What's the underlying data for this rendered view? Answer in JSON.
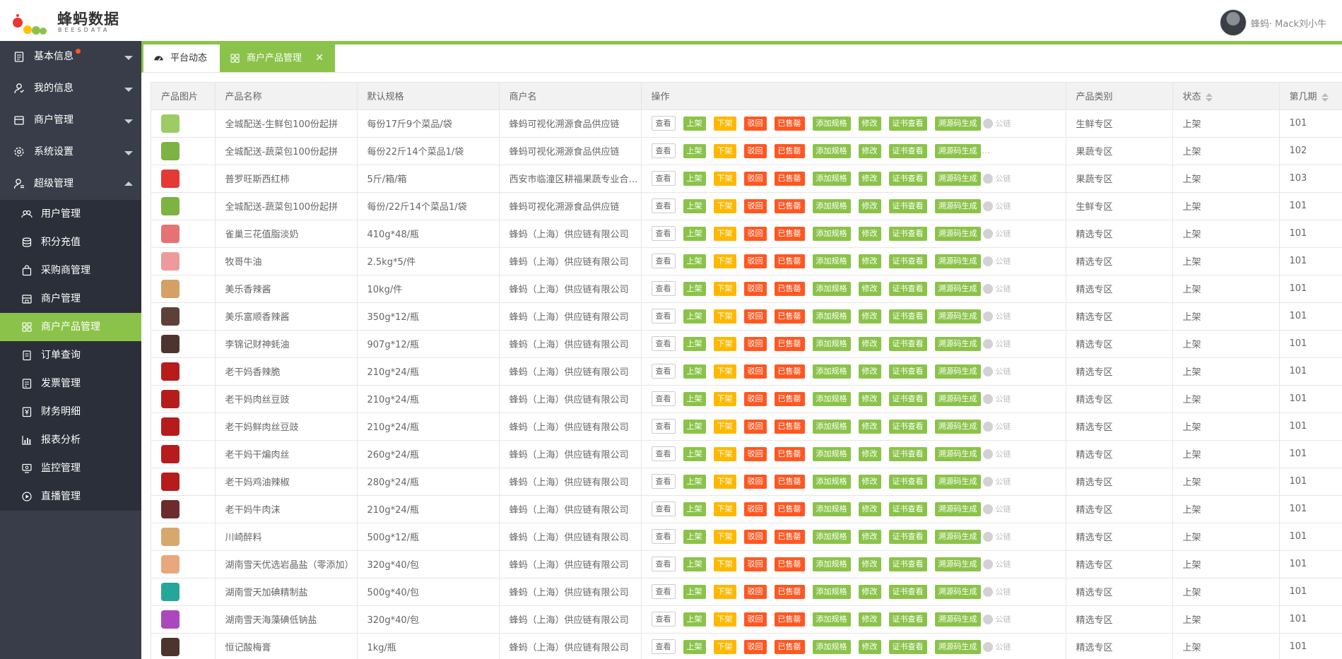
{
  "brand": {
    "name": "蜂蚂数据",
    "sub": "BEESDATA"
  },
  "user": {
    "name": "蜂蚂· Mack刘小牛"
  },
  "sidebar": {
    "top": [
      {
        "label": "基本信息",
        "icon": "clipboard-icon",
        "badge": true
      },
      {
        "label": "我的信息",
        "icon": "user-icon"
      },
      {
        "label": "商户管理",
        "icon": "store-icon"
      },
      {
        "label": "系统设置",
        "icon": "gear-icon"
      },
      {
        "label": "超级管理",
        "icon": "admin-user-icon",
        "expanded": true
      }
    ],
    "sub": [
      {
        "label": "用户管理",
        "icon": "users-icon"
      },
      {
        "label": "积分充值",
        "icon": "database-icon"
      },
      {
        "label": "采购商管理",
        "icon": "bag-icon"
      },
      {
        "label": "商户管理",
        "icon": "shop-icon"
      },
      {
        "label": "商户产品管理",
        "icon": "grid-icon",
        "active": true
      },
      {
        "label": "订单查询",
        "icon": "order-icon"
      },
      {
        "label": "发票管理",
        "icon": "invoice-icon"
      },
      {
        "label": "财务明细",
        "icon": "finance-icon"
      },
      {
        "label": "报表分析",
        "icon": "bar-chart-icon"
      },
      {
        "label": "监控管理",
        "icon": "monitor-icon"
      },
      {
        "label": "直播管理",
        "icon": "play-icon"
      }
    ]
  },
  "tabs": [
    {
      "label": "平台动态",
      "icon": "dashboard-icon"
    },
    {
      "label": "商户产品管理",
      "icon": "grid-icon",
      "active": true,
      "close": "✕"
    }
  ],
  "table": {
    "headers": [
      "产品图片",
      "产品名称",
      "默认规格",
      "商户名",
      "操作",
      "产品类别",
      "状态",
      "第几期"
    ],
    "op_labels": {
      "view": "查看",
      "on": "上架",
      "off": "下架",
      "reject": "驳回",
      "sold": "已售罄",
      "add_spec": "添加规格",
      "edit": "修改",
      "cert": "证书查看",
      "trace": "溯源码生成",
      "chain": "公链",
      "more": "…"
    },
    "colors": {
      "green": "#8bc34a",
      "orange": "#ffb800",
      "red": "#ff5722"
    },
    "rows": [
      {
        "name": "全城配送-生鲜包100份起拼",
        "spec": "每份17斤9个菜品/袋",
        "merchant": "蜂蚂可视化溯源食品供应链",
        "category": "生鲜专区",
        "status": "上架",
        "period": "101",
        "thumb": "#9ccc65",
        "chain": true
      },
      {
        "name": "全城配送-蔬菜包100份起拼",
        "spec": "每份22斤14个菜品1/袋",
        "merchant": "蜂蚂可视化溯源食品供应链",
        "category": "果蔬专区",
        "status": "上架",
        "period": "102",
        "thumb": "#7cb342",
        "chain": false
      },
      {
        "name": "普罗旺斯西红柿",
        "spec": "5斤/箱/箱",
        "merchant": "西安市临潼区耕福果蔬专业合作社",
        "category": "果蔬专区",
        "status": "上架",
        "period": "103",
        "thumb": "#e53935",
        "chain": true
      },
      {
        "name": "全城配送-蔬菜包100份起拼",
        "spec": "每份/22斤14个菜品1/袋",
        "merchant": "蜂蚂可视化溯源食品供应链",
        "category": "生鲜专区",
        "status": "上架",
        "period": "101",
        "thumb": "#7cb342",
        "chain": true
      },
      {
        "name": "雀巢三花值脂淡奶",
        "spec": "410g*48/瓶",
        "merchant": "蜂蚂（上海）供应链有限公司",
        "category": "精选专区",
        "status": "上架",
        "period": "101",
        "thumb": "#e57373",
        "chain": true
      },
      {
        "name": "牧哥牛油",
        "spec": "2.5kg*5/件",
        "merchant": "蜂蚂（上海）供应链有限公司",
        "category": "精选专区",
        "status": "上架",
        "period": "101",
        "thumb": "#ef9a9a",
        "chain": true
      },
      {
        "name": "美乐香辣酱",
        "spec": "10kg/件",
        "merchant": "蜂蚂（上海）供应链有限公司",
        "category": "精选专区",
        "status": "上架",
        "period": "101",
        "thumb": "#d4a066",
        "chain": true
      },
      {
        "name": "美乐富顺香辣酱",
        "spec": "350g*12/瓶",
        "merchant": "蜂蚂（上海）供应链有限公司",
        "category": "精选专区",
        "status": "上架",
        "period": "101",
        "thumb": "#5d4037",
        "chain": true
      },
      {
        "name": "李锦记财神蚝油",
        "spec": "907g*12/瓶",
        "merchant": "蜂蚂（上海）供应链有限公司",
        "category": "精选专区",
        "status": "上架",
        "period": "101",
        "thumb": "#4e342e",
        "chain": true
      },
      {
        "name": "老干妈香辣脆",
        "spec": "210g*24/瓶",
        "merchant": "蜂蚂（上海）供应链有限公司",
        "category": "精选专区",
        "status": "上架",
        "period": "101",
        "thumb": "#b71c1c",
        "chain": true
      },
      {
        "name": "老干妈肉丝豆豉",
        "spec": "210g*24/瓶",
        "merchant": "蜂蚂（上海）供应链有限公司",
        "category": "精选专区",
        "status": "上架",
        "period": "101",
        "thumb": "#b71c1c",
        "chain": true
      },
      {
        "name": "老干妈鲜肉丝豆豉",
        "spec": "210g*24/瓶",
        "merchant": "蜂蚂（上海）供应链有限公司",
        "category": "精选专区",
        "status": "上架",
        "period": "101",
        "thumb": "#b71c1c",
        "chain": true
      },
      {
        "name": "老干妈干煸肉丝",
        "spec": "260g*24/瓶",
        "merchant": "蜂蚂（上海）供应链有限公司",
        "category": "精选专区",
        "status": "上架",
        "period": "101",
        "thumb": "#b71c1c",
        "chain": true
      },
      {
        "name": "老干妈鸡油辣椒",
        "spec": "280g*24/瓶",
        "merchant": "蜂蚂（上海）供应链有限公司",
        "category": "精选专区",
        "status": "上架",
        "period": "101",
        "thumb": "#b71c1c",
        "chain": true
      },
      {
        "name": "老干妈牛肉沫",
        "spec": "210g*24/瓶",
        "merchant": "蜂蚂（上海）供应链有限公司",
        "category": "精选专区",
        "status": "上架",
        "period": "101",
        "thumb": "#6d2b2b",
        "chain": true
      },
      {
        "name": "川崎醉料",
        "spec": "500g*12/瓶",
        "merchant": "蜂蚂（上海）供应链有限公司",
        "category": "精选专区",
        "status": "上架",
        "period": "101",
        "thumb": "#d7a86e",
        "chain": true
      },
      {
        "name": "湖南雪天优选岩晶盐（零添加）",
        "spec": "320g*40/包",
        "merchant": "蜂蚂（上海）供应链有限公司",
        "category": "精选专区",
        "status": "上架",
        "period": "101",
        "thumb": "#e8a87c",
        "chain": true
      },
      {
        "name": "湖南雪天加碘精制盐",
        "spec": "500g*40/包",
        "merchant": "蜂蚂（上海）供应链有限公司",
        "category": "精选专区",
        "status": "上架",
        "period": "101",
        "thumb": "#26a69a",
        "chain": true
      },
      {
        "name": "湖南雪天海藻碘低钠盐",
        "spec": "320g*40/包",
        "merchant": "蜂蚂（上海）供应链有限公司",
        "category": "精选专区",
        "status": "上架",
        "period": "101",
        "thumb": "#ab47bc",
        "chain": true
      },
      {
        "name": "恒记酸梅膏",
        "spec": "1kg/瓶",
        "merchant": "蜂蚂（上海）供应链有限公司",
        "category": "精选专区",
        "status": "上架",
        "period": "101",
        "thumb": "#4e342e",
        "chain": true
      }
    ]
  }
}
